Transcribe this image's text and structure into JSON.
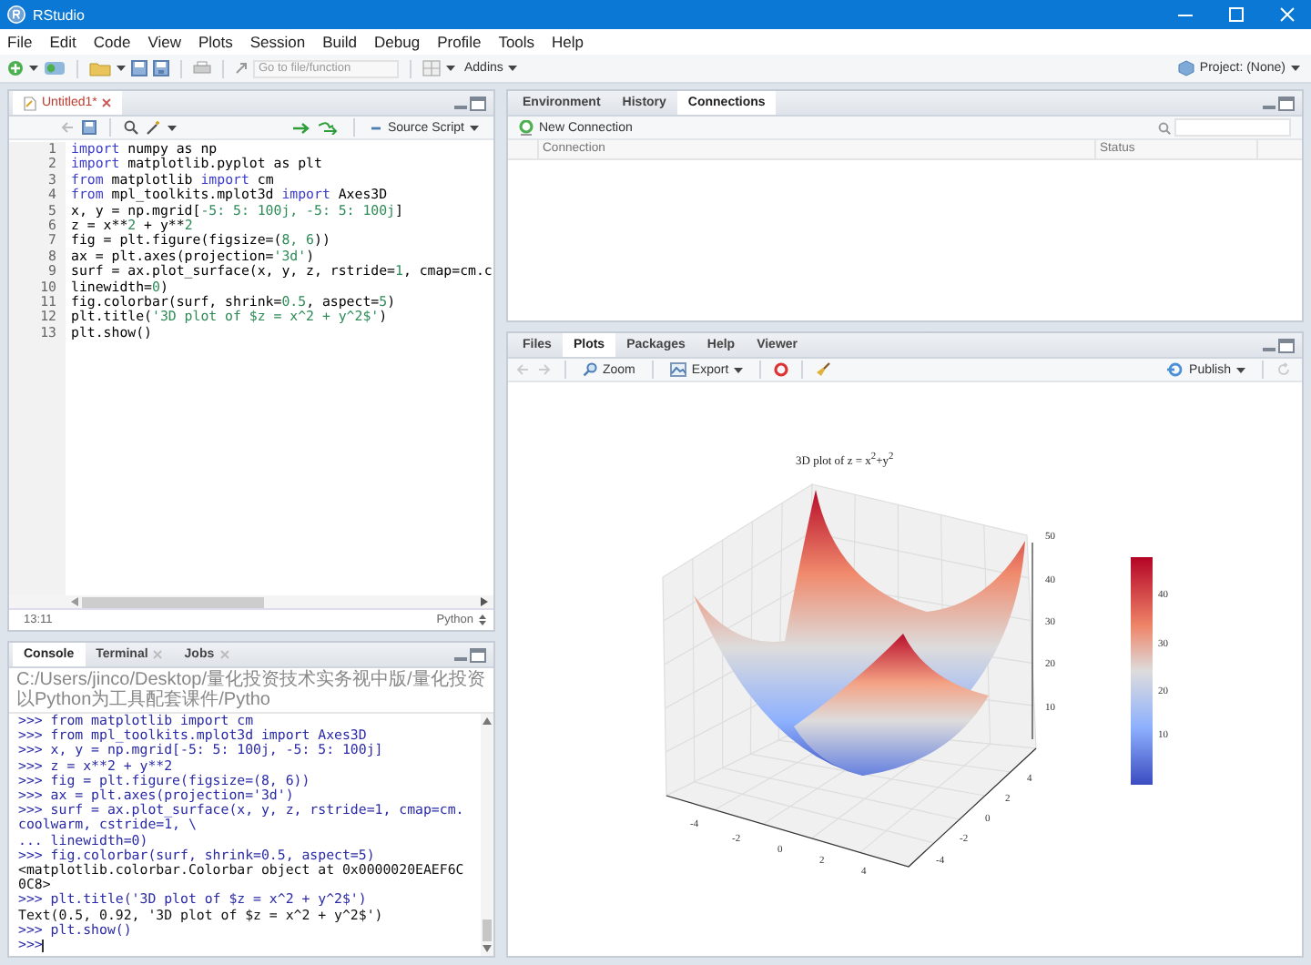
{
  "window": {
    "title": "RStudio"
  },
  "menu": [
    "File",
    "Edit",
    "Code",
    "View",
    "Plots",
    "Session",
    "Build",
    "Debug",
    "Profile",
    "Tools",
    "Help"
  ],
  "toolbar": {
    "goto_placeholder": "Go to file/function",
    "addins": "Addins",
    "project": "Project: (None)"
  },
  "editor": {
    "tabs": [
      {
        "label": "Untitled1*",
        "selected": true
      }
    ],
    "source_button": "Source Script",
    "lines": [
      {
        "number": "1",
        "tokens": [
          {
            "kind": "keyword",
            "text": "import"
          },
          {
            "kind": "plain",
            "text": " numpy as np"
          }
        ]
      },
      {
        "number": "2",
        "tokens": [
          {
            "kind": "keyword",
            "text": "import"
          },
          {
            "kind": "plain",
            "text": " matplotlib.pyplot as plt"
          }
        ]
      },
      {
        "number": "3",
        "tokens": [
          {
            "kind": "keyword",
            "text": "from"
          },
          {
            "kind": "plain",
            "text": " matplotlib "
          },
          {
            "kind": "keyword",
            "text": "import"
          },
          {
            "kind": "plain",
            "text": " cm"
          }
        ]
      },
      {
        "number": "4",
        "tokens": [
          {
            "kind": "keyword",
            "text": "from"
          },
          {
            "kind": "plain",
            "text": " mpl_toolkits.mplot3d "
          },
          {
            "kind": "keyword",
            "text": "import"
          },
          {
            "kind": "plain",
            "text": " Axes3D"
          }
        ]
      },
      {
        "number": "5",
        "tokens": [
          {
            "kind": "plain",
            "text": "x, y = np.mgrid["
          },
          {
            "kind": "number",
            "text": "-5: 5: 100j, -5: 5: 100j"
          },
          {
            "kind": "plain",
            "text": "]"
          }
        ]
      },
      {
        "number": "6",
        "tokens": [
          {
            "kind": "plain",
            "text": "z = x**"
          },
          {
            "kind": "number",
            "text": "2"
          },
          {
            "kind": "plain",
            "text": " + y**"
          },
          {
            "kind": "number",
            "text": "2"
          }
        ]
      },
      {
        "number": "7",
        "tokens": [
          {
            "kind": "plain",
            "text": "fig = plt.figure(figsize=("
          },
          {
            "kind": "number",
            "text": "8, 6"
          },
          {
            "kind": "plain",
            "text": "))"
          }
        ]
      },
      {
        "number": "8",
        "tokens": [
          {
            "kind": "plain",
            "text": "ax = plt.axes(projection="
          },
          {
            "kind": "string",
            "text": "'3d'"
          },
          {
            "kind": "plain",
            "text": ")"
          }
        ]
      },
      {
        "number": "9",
        "tokens": [
          {
            "kind": "plain",
            "text": "surf = ax.plot_surface(x, y, z, rstride="
          },
          {
            "kind": "number",
            "text": "1"
          },
          {
            "kind": "plain",
            "text": ", cmap=cm.c"
          }
        ]
      },
      {
        "number": "10",
        "tokens": [
          {
            "kind": "plain",
            "text": "linewidth="
          },
          {
            "kind": "number",
            "text": "0"
          },
          {
            "kind": "plain",
            "text": ")"
          }
        ]
      },
      {
        "number": "11",
        "tokens": [
          {
            "kind": "plain",
            "text": "fig.colorbar(surf, shrink="
          },
          {
            "kind": "number",
            "text": "0.5"
          },
          {
            "kind": "plain",
            "text": ", aspect="
          },
          {
            "kind": "number",
            "text": "5"
          },
          {
            "kind": "plain",
            "text": ")"
          }
        ]
      },
      {
        "number": "12",
        "tokens": [
          {
            "kind": "plain",
            "text": "plt.title("
          },
          {
            "kind": "string",
            "text": "'3D plot of $z = x^2 + y^2$'"
          },
          {
            "kind": "plain",
            "text": ")"
          }
        ]
      },
      {
        "number": "13",
        "tokens": [
          {
            "kind": "plain",
            "text": "plt.show()"
          }
        ]
      }
    ],
    "position": "13:11",
    "language": "Python"
  },
  "console": {
    "tabs": [
      {
        "label": "Console",
        "selected": true
      },
      {
        "label": "Terminal",
        "selected": false
      },
      {
        "label": "Jobs",
        "selected": false
      }
    ],
    "path": "C:/Users/jinco/Desktop/量化投资技术实务视中版/量化投资以Python为工具配套课件/Pytho",
    "lines": [
      {
        "kind": "input",
        "text": ">>> from matplotlib import cm"
      },
      {
        "kind": "input",
        "text": ">>> from mpl_toolkits.mplot3d import Axes3D"
      },
      {
        "kind": "input",
        "text": ">>> x, y = np.mgrid[-5: 5: 100j, -5: 5: 100j]"
      },
      {
        "kind": "input",
        "text": ">>> z = x**2 + y**2"
      },
      {
        "kind": "input",
        "text": ">>> fig = plt.figure(figsize=(8, 6))"
      },
      {
        "kind": "input",
        "text": ">>> ax = plt.axes(projection='3d')"
      },
      {
        "kind": "input",
        "text": ">>> surf = ax.plot_surface(x, y, z, rstride=1, cmap=cm."
      },
      {
        "kind": "input",
        "text": "coolwarm, cstride=1, \\"
      },
      {
        "kind": "input",
        "text": "... linewidth=0)"
      },
      {
        "kind": "input",
        "text": ">>> fig.colorbar(surf, shrink=0.5, aspect=5)"
      },
      {
        "kind": "output",
        "text": "<matplotlib.colorbar.Colorbar object at 0x0000020EAEF6C"
      },
      {
        "kind": "output",
        "text": "0C8>"
      },
      {
        "kind": "input",
        "text": ">>> plt.title('3D plot of $z = x^2 + y^2$')"
      },
      {
        "kind": "output",
        "text": "Text(0.5, 0.92, '3D plot of $z = x^2 + y^2$')"
      },
      {
        "kind": "input",
        "text": ">>> plt.show()"
      },
      {
        "kind": "prompt",
        "text": ">>>"
      }
    ]
  },
  "environment": {
    "tabs": [
      {
        "label": "Environment",
        "selected": false
      },
      {
        "label": "History",
        "selected": false
      },
      {
        "label": "Connections",
        "selected": true
      }
    ],
    "new_connection": "New Connection",
    "columns": [
      "Connection",
      "Status"
    ]
  },
  "plots": {
    "tabs": [
      {
        "label": "Files",
        "selected": false
      },
      {
        "label": "Plots",
        "selected": true
      },
      {
        "label": "Packages",
        "selected": false
      },
      {
        "label": "Help",
        "selected": false
      },
      {
        "label": "Viewer",
        "selected": false
      }
    ],
    "zoom": "Zoom",
    "export": "Export",
    "publish": "Publish",
    "figure": {
      "title": "3D plot of z = x$^{2}$+y$^{2}$",
      "x_ticks": [
        "-4",
        "-2",
        "0",
        "2",
        "4"
      ],
      "y_ticks": [
        "4",
        "2",
        "0",
        "-2",
        "-4"
      ],
      "z_ticks": [
        "50",
        "40",
        "30",
        "20",
        "10"
      ],
      "colorbar_ticks": [
        "40",
        "30",
        "20",
        "10"
      ]
    }
  }
}
